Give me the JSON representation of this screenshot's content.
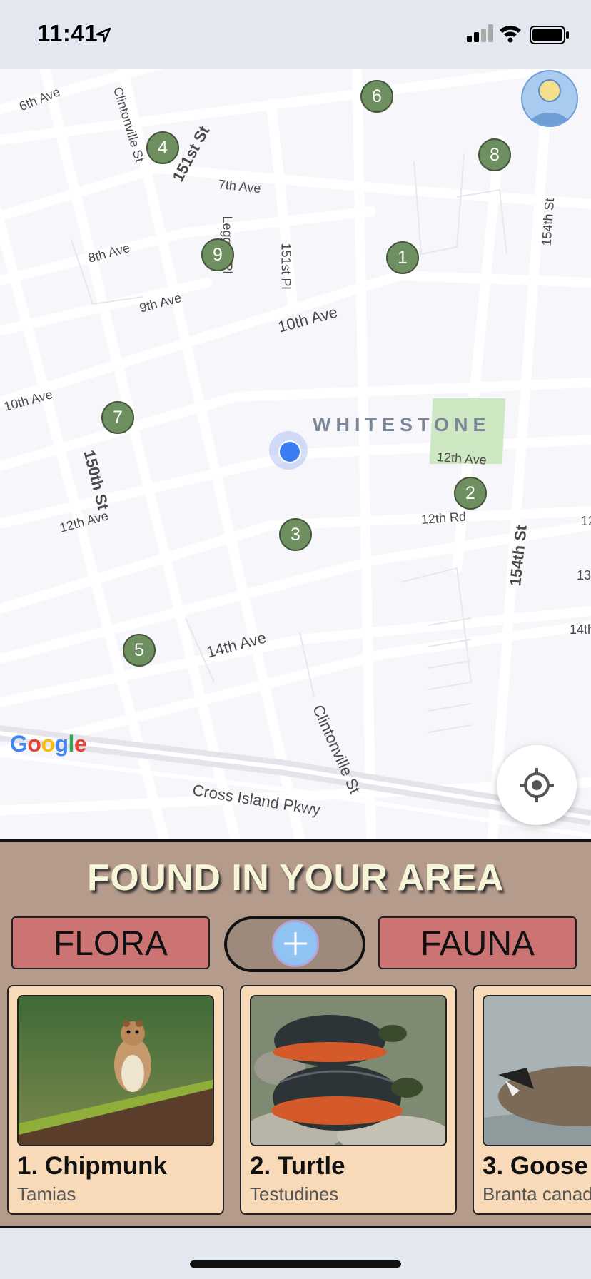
{
  "status": {
    "time": "11:41"
  },
  "map": {
    "district": "WHITESTONE",
    "google": "Google",
    "roads": {
      "sixth_ave": "6th Ave",
      "clintonville_top": "Clintonville St",
      "st151": "151st St",
      "seventh_ave": "7th Ave",
      "leggett": "Leggett Pl",
      "pl151": "151st Pl",
      "eighth_ave": "8th Ave",
      "st154_top": "154th St",
      "ninth_ave": "9th Ave",
      "tenth_ave": "10th Ave",
      "tenth_ave_left": "10th Ave",
      "st150": "150th St",
      "twelfth_ave_right": "12th Ave",
      "twelfth_ave_left": "12th Ave",
      "twelfth_rd": "12th Rd",
      "twelfth_rd_edge": "12",
      "st154": "154th St",
      "thirteen_edge": "13",
      "fourteenth_ave": "14th Ave",
      "fourteenth_edge": "14th",
      "clintonville_bottom": "Clintonville St",
      "cross_island": "Cross Island Pkwy"
    },
    "markers": [
      "1",
      "2",
      "3",
      "4",
      "5",
      "6",
      "7",
      "8",
      "9"
    ]
  },
  "panel": {
    "title": "FOUND IN YOUR AREA",
    "flora_label": "FLORA",
    "fauna_label": "FAUNA",
    "cards": [
      {
        "name": "1. Chipmunk",
        "scientific": "Tamias",
        "image": "chipmunk-photo"
      },
      {
        "name": "2. Turtle",
        "scientific": "Testudines",
        "image": "turtle-photo"
      },
      {
        "name": "3. Goose",
        "scientific": "Branta canadensis",
        "image": "goose-photo"
      }
    ]
  },
  "colors": {
    "marker": "#6e8f5f",
    "panel_bg": "#b59b8c",
    "button": "#cc7474",
    "card_bg": "#f8d9b8",
    "user_dot": "#3b7cf3"
  }
}
